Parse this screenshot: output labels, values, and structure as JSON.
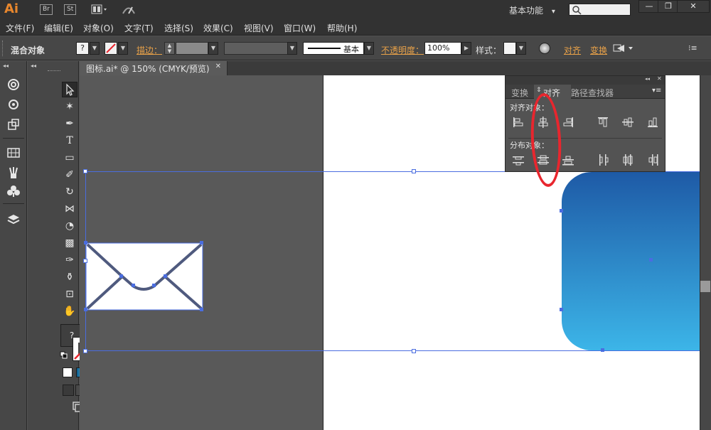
{
  "app": {
    "logo": "Ai",
    "badges": [
      "Br",
      "St"
    ],
    "workspace": "基本功能",
    "workspace_arrow": "▾",
    "window_buttons": [
      "—",
      "❐",
      "✕"
    ]
  },
  "menu": [
    "文件(F)",
    "编辑(E)",
    "对象(O)",
    "文字(T)",
    "选择(S)",
    "效果(C)",
    "视图(V)",
    "窗口(W)",
    "帮助(H)"
  ],
  "control": {
    "object_type": "混合对象",
    "stroke_label": "描边：",
    "stroke_style": "基本",
    "opacity_label": "不透明度：",
    "opacity_value": "100%",
    "style_label": "样式：",
    "align_link": "对齐",
    "transform_link": "变换",
    "fill_q": "?"
  },
  "document": {
    "tab_title": "图标.ai* @ 150% (CMYK/预览)",
    "tab_close": "✕"
  },
  "align_panel": {
    "tabs": [
      "变换",
      "对齐",
      "路径查找器"
    ],
    "active_tab": "对齐",
    "section_align": "对齐对象：",
    "section_distribute": "分布对象："
  },
  "toolbox": {
    "fill_q": "?"
  },
  "colors": {
    "accent": "#e8872d",
    "selection": "#4a6de0",
    "highlight": "#e8262e",
    "gradient_top": "#1e5aa6",
    "gradient_bottom": "#3cb5e8"
  }
}
